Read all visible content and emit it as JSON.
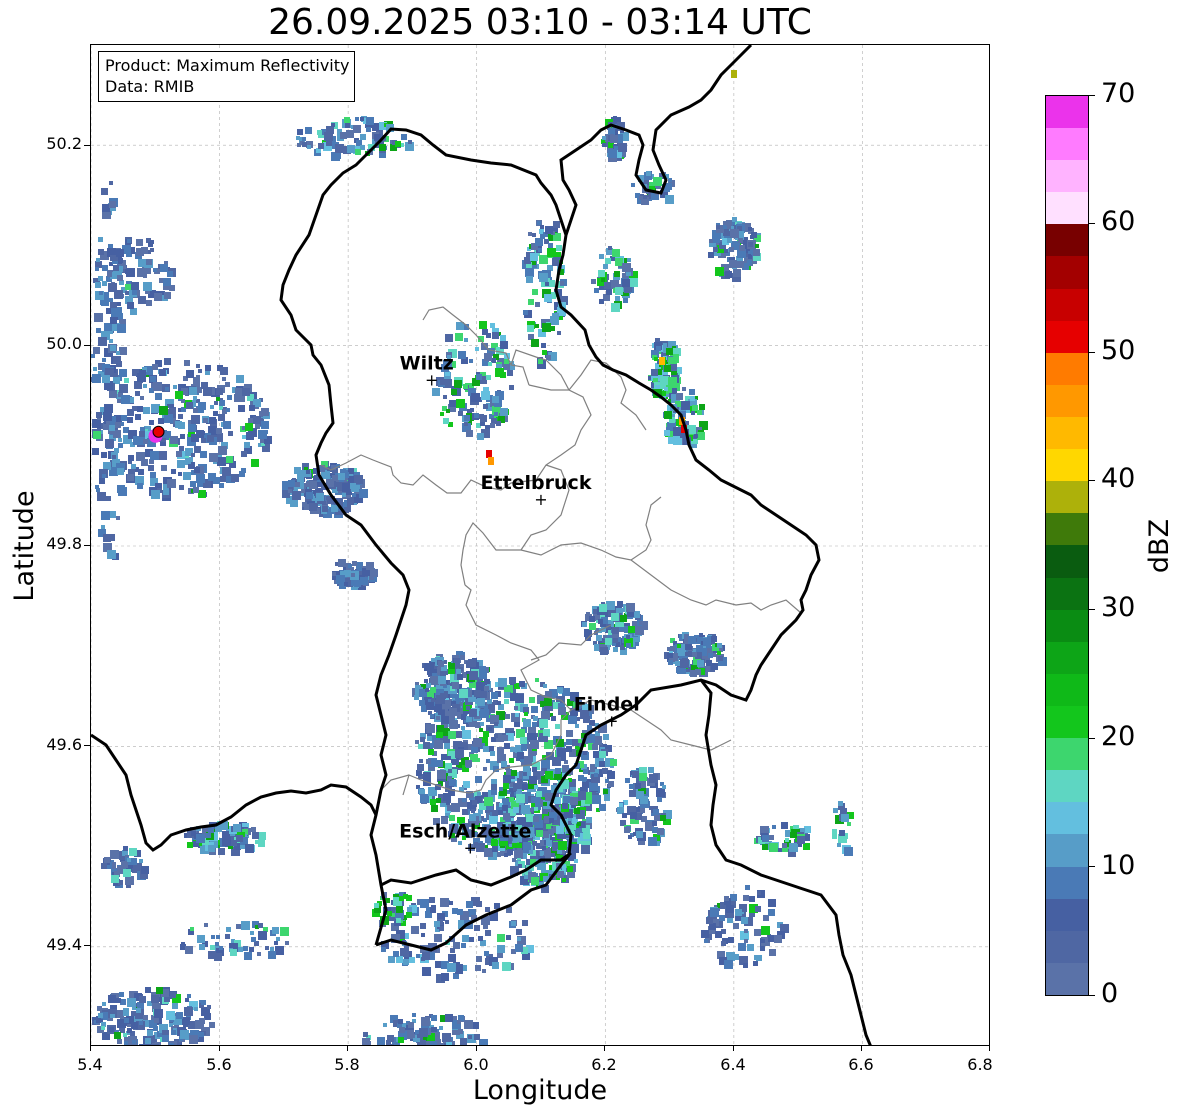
{
  "title": "26.09.2025 03:10 - 03:14 UTC",
  "info_box": {
    "product": "Product: Maximum Reflectivity",
    "data": "Data: RMIB"
  },
  "axes": {
    "xlabel": "Longitude",
    "ylabel": "Latitude",
    "xlim": [
      5.4,
      6.8
    ],
    "ylim": [
      49.3,
      50.3
    ],
    "xticks": [
      "5.4",
      "5.6",
      "5.8",
      "6.0",
      "6.2",
      "6.4",
      "6.6",
      "6.8"
    ],
    "yticks": [
      "49.4",
      "49.6",
      "49.8",
      "50.0",
      "50.2"
    ],
    "grid": true
  },
  "colorbar": {
    "label": "dBZ",
    "min": 0,
    "max": 70,
    "ticks": [
      "0",
      "10",
      "20",
      "30",
      "40",
      "50",
      "60",
      "70"
    ],
    "colors": [
      "#5a72a8",
      "#4f67a3",
      "#4660a2",
      "#4a7ab6",
      "#579dc8",
      "#63bfdf",
      "#5ed6c2",
      "#3dd66e",
      "#13c61c",
      "#0fb918",
      "#0da517",
      "#0a8c13",
      "#0b7312",
      "#0a5c10",
      "#3f7a0a",
      "#adb10a",
      "#ffd700",
      "#ffb900",
      "#ff9800",
      "#ff7b00",
      "#e60000",
      "#c80000",
      "#a30000",
      "#780000",
      "#ffe0ff",
      "#ffb3ff",
      "#ff7bff",
      "#eb33eb"
    ]
  },
  "cities": [
    {
      "name": "Wiltz",
      "lon": 5.93,
      "lat": 49.966
    },
    {
      "name": "Ettelbruck",
      "lon": 6.1,
      "lat": 49.847
    },
    {
      "name": "Findel",
      "lon": 6.21,
      "lat": 49.626
    },
    {
      "name": "Esch/Alzette",
      "lon": 5.99,
      "lat": 49.499
    }
  ],
  "radar_site_marker": {
    "lon": 5.505,
    "lat": 49.914
  }
}
